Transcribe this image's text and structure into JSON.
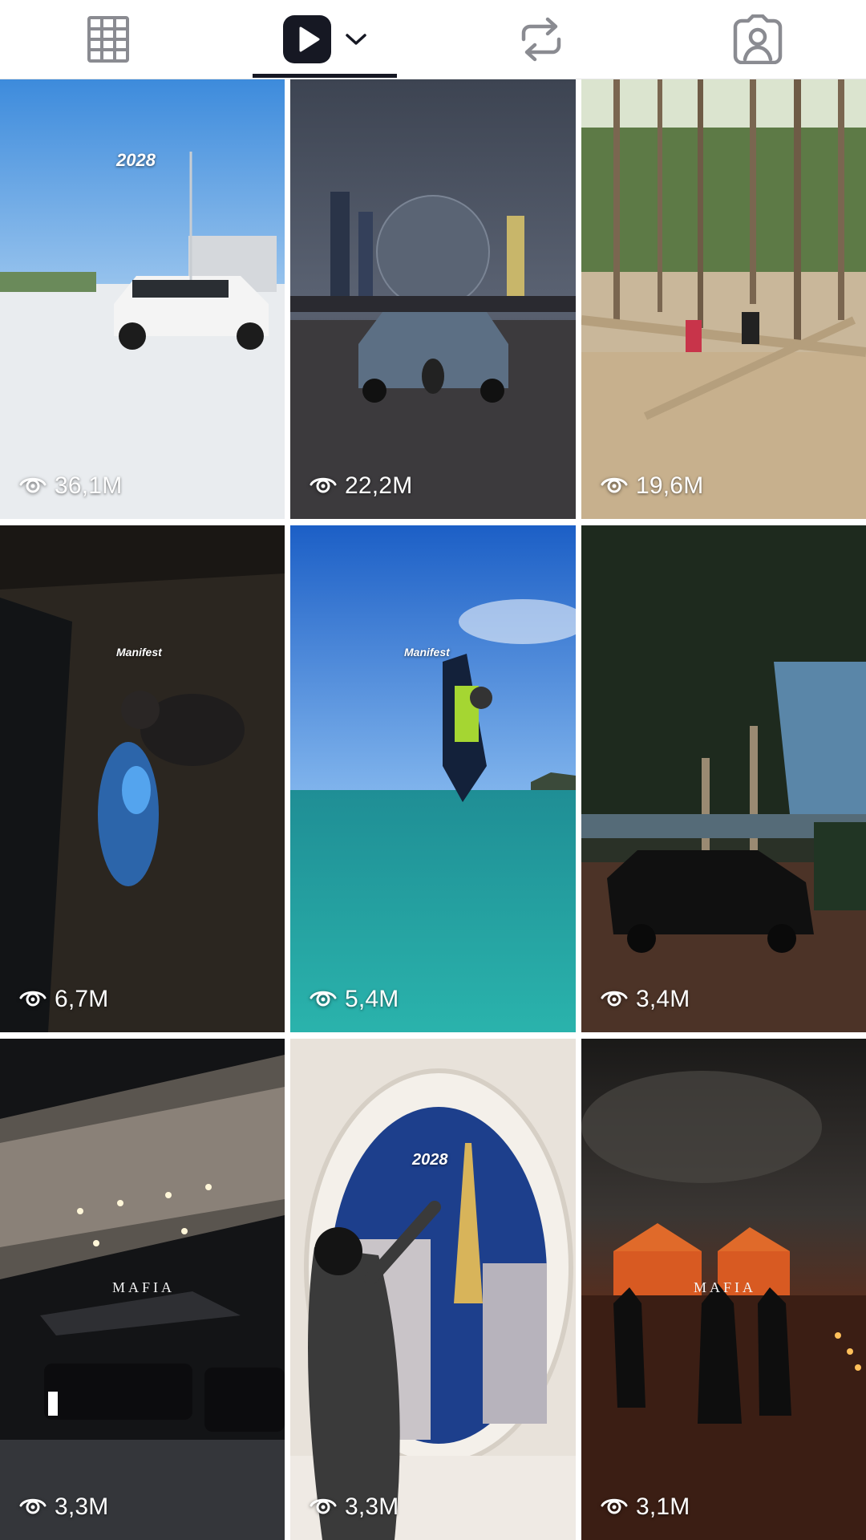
{
  "tabs": [
    {
      "icon": "grid-icon",
      "label": "Posts"
    },
    {
      "icon": "play-icon",
      "label": "Videos",
      "active": true,
      "has_dropdown": true
    },
    {
      "icon": "repost-icon",
      "label": "Reposts"
    },
    {
      "icon": "tagged-person-icon",
      "label": "Tagged"
    }
  ],
  "videos": [
    {
      "views": "36,1M",
      "scene": "white supercar on highway",
      "overlay": "2028"
    },
    {
      "views": "22,2M",
      "scene": "blue hypercar in front of city dome",
      "overlay": ""
    },
    {
      "views": "19,6M",
      "scene": "pine forest with picnic table",
      "overlay": ""
    },
    {
      "views": "6,7M",
      "scene": "night beach with bioluminescent water",
      "overlay": "Manifest"
    },
    {
      "views": "5,4M",
      "scene": "jet ski jump over turquoise sea",
      "overlay": "Manifest"
    },
    {
      "views": "3,4M",
      "scene": "black hypercar in park at dusk",
      "overlay": ""
    },
    {
      "views": "3,3M",
      "scene": "private jet and luxury cars at night",
      "overlay": "MAFIA"
    },
    {
      "views": "3,3M",
      "scene": "woman at round window facing Eiffel tower",
      "overlay": "2028"
    },
    {
      "views": "3,1M",
      "scene": "crowd before lit temple at night",
      "overlay": "MAFIA"
    }
  ],
  "colors": {
    "active_tab": "#161823",
    "inactive_icon": "#8a8b91",
    "divider": "#e6e6e6"
  }
}
